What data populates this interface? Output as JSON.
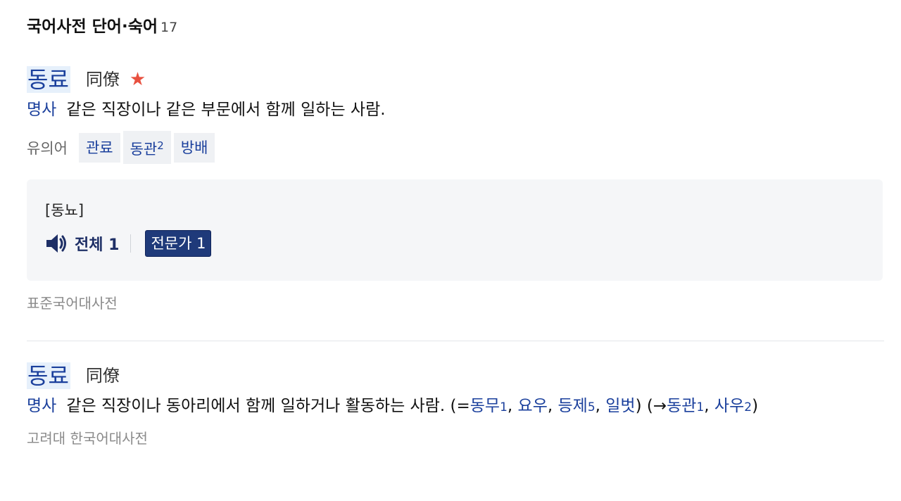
{
  "section": {
    "title": "국어사전 단어·숙어",
    "count": "17"
  },
  "entries": [
    {
      "word": "동료",
      "hanja": "同僚",
      "star": "★",
      "pos": "명사",
      "definition": "같은 직장이나 같은 부문에서 함께 일하는 사람.",
      "synonym_label": "유의어",
      "synonyms": [
        {
          "text": "관료",
          "sup": ""
        },
        {
          "text": "동관",
          "sup": "2"
        },
        {
          "text": "방배",
          "sup": ""
        }
      ],
      "pronunciation": "[동뇨]",
      "audio": {
        "all_label": "전체 1",
        "expert_label": "전문가 1"
      },
      "source": "표준국어대사전"
    },
    {
      "word": "동료",
      "hanja": "同僚",
      "pos": "명사",
      "definition_prefix": "같은 직장이나 동아리에서 함께 일하거나 활동하는 사람. (=",
      "eq_refs": [
        {
          "text": "동무",
          "num": "1"
        },
        {
          "text": "요우",
          "num": ""
        },
        {
          "text": "등제",
          "num": "5"
        },
        {
          "text": "일벗",
          "num": ""
        }
      ],
      "mid_text": ") (→",
      "see_refs": [
        {
          "text": "동관",
          "num": "1"
        },
        {
          "text": "사우",
          "num": "2"
        }
      ],
      "close_paren": ")",
      "comma": ", ",
      "source": "고려대 한국어대사전"
    }
  ],
  "colors": {
    "link": "#1a3f9c",
    "word_bg": "#e6f0fb",
    "star": "#e8503f",
    "expert_bg": "#1f3a7a",
    "box_bg": "#f5f6f8"
  },
  "icons": {
    "star": "star-icon",
    "speaker": "speaker-icon"
  }
}
